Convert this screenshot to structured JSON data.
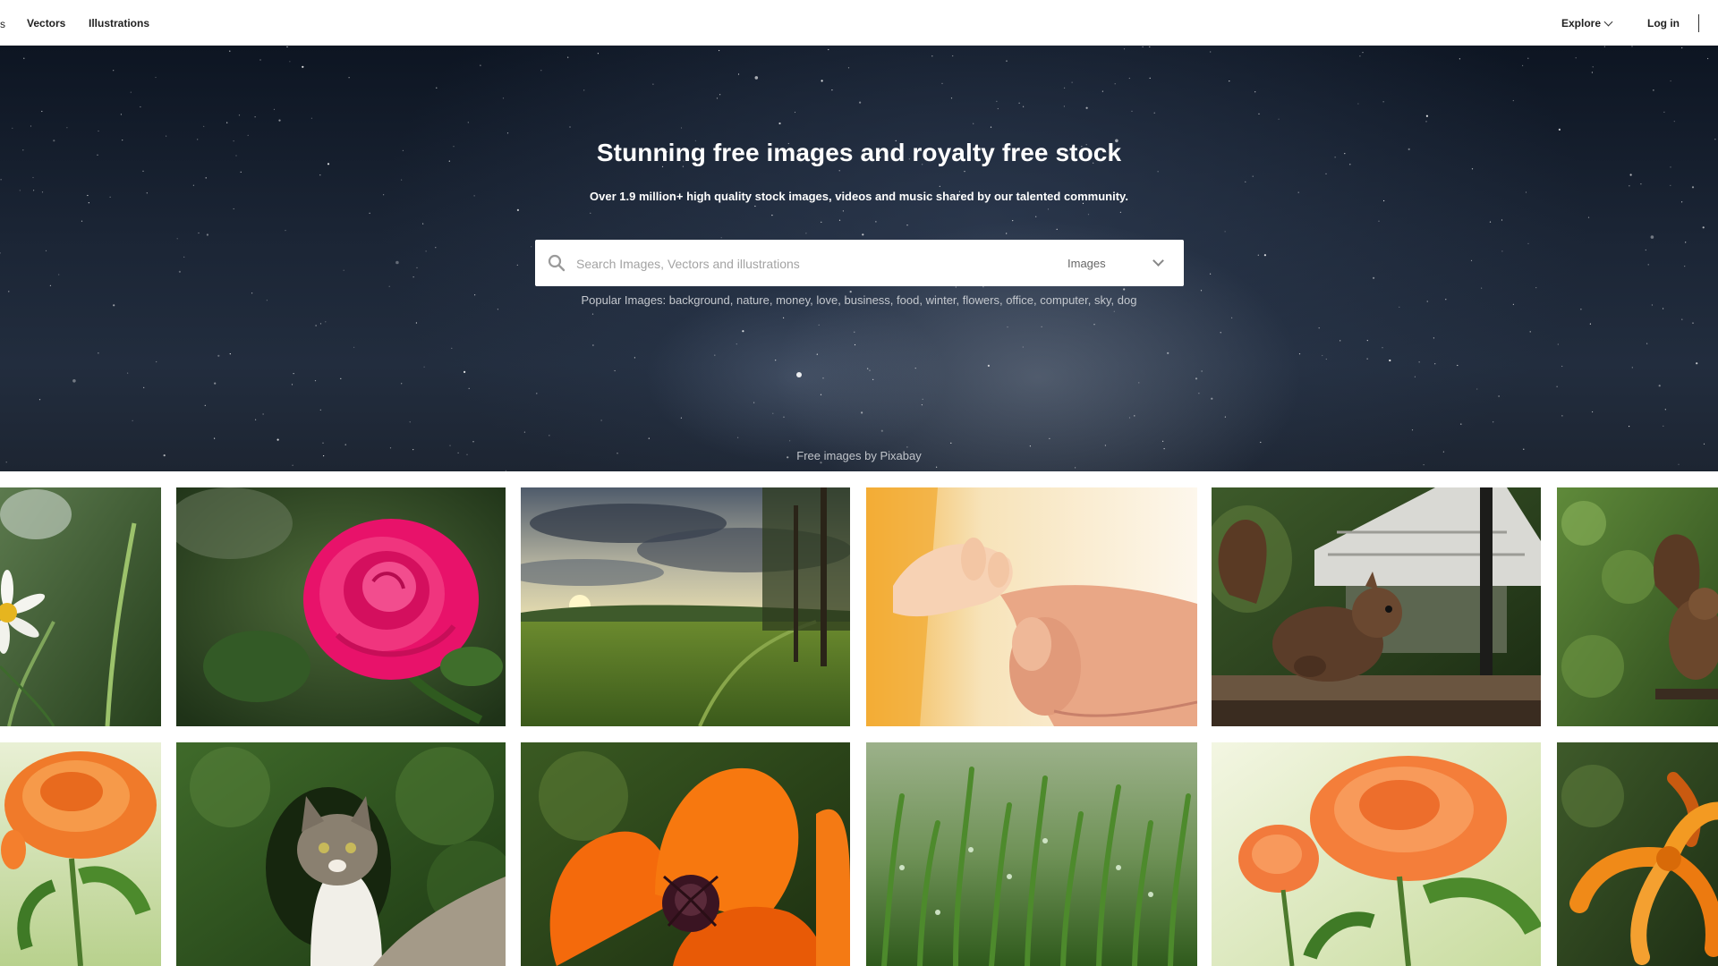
{
  "nav": {
    "edge_fragment": "s",
    "links": [
      "Vectors",
      "Illustrations"
    ],
    "explore_label": "Explore",
    "login_label": "Log in"
  },
  "hero": {
    "title": "Stunning free images and royalty free stock",
    "subtitle": "Over 1.9 million+ high quality stock images, videos and music shared by our talented community.",
    "search": {
      "placeholder": "Search Images, Vectors and illustrations",
      "value": "",
      "type_selected": "Images"
    },
    "popular_label": "Popular Images:",
    "popular_tags": [
      "background",
      "nature",
      "money",
      "love",
      "business",
      "food",
      "winter",
      "flowers",
      "office",
      "computer",
      "sky",
      "dog"
    ],
    "credit": "Free images by Pixabay"
  },
  "gallery": {
    "rows": [
      [
        "daisy-photo",
        "pink-rose-photo",
        "field-sunset-photo",
        "baby-hand-photo",
        "squirrel-feeder-photo",
        "squirrel-tree-photo"
      ],
      [
        "orange-rose-photo",
        "cat-hedge-photo",
        "orange-poppy-photo",
        "dewy-grass-photo",
        "peach-roses-photo",
        "orange-lily-photo"
      ]
    ]
  }
}
